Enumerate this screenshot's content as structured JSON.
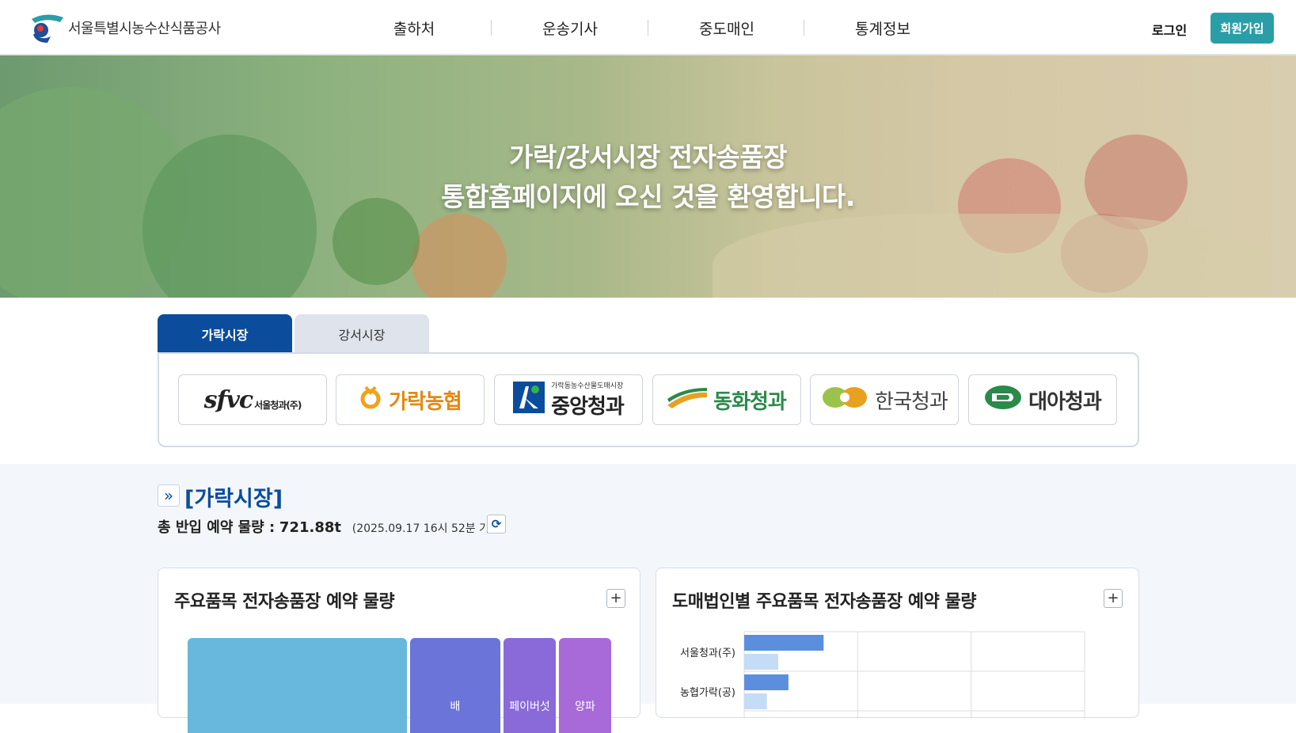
{
  "header": {
    "brand": "서울특별시농수산식품공사",
    "nav": [
      "출하처",
      "운송기사",
      "중도매인",
      "통계정보"
    ],
    "login": "로그인",
    "join": "회원가입",
    "colors": {
      "accent": "#2a9ea7",
      "primary": "#0b4c9c"
    }
  },
  "hero": {
    "line1": "가락/강서시장 전자송품장",
    "line2": "통합홈페이지에 오신 것을 환영합니다."
  },
  "market_tabs": {
    "active": "가락시장",
    "inactive": "강서시장"
  },
  "companies": [
    {
      "name": "서울청과(주)",
      "logo_text": "sfvc",
      "icon": "sfvc-logo-icon"
    },
    {
      "name": "가락농협",
      "icon": "garak-nonghyup-icon",
      "color": "#e5880f"
    },
    {
      "name": "중앙청과",
      "subtitle": "가락동농수산물도매시장",
      "icon": "jungang-logo-icon",
      "color": "#0b4c9c"
    },
    {
      "name": "동화청과",
      "icon": "donghwa-logo-icon",
      "color": "#2a8a4a"
    },
    {
      "name": "한국청과",
      "icon": "hankook-logo-icon",
      "color": "#444444"
    },
    {
      "name": "대아청과",
      "icon": "daea-logo-icon",
      "color": "#333333"
    }
  ],
  "section": {
    "title": "[가락시장]",
    "total_label": "총 반입 예약 물량 :",
    "total_value": "721.88t",
    "as_of": "(2025.09.17  16시 52분 기준)"
  },
  "cards": {
    "left_title": "주요품목 전자송품장 예약 물량",
    "right_title": "도매법인별 주요품목 전자송품장 예약 물량"
  },
  "treemap": {
    "cells": [
      {
        "label": "",
        "color": "#68b7dc"
      },
      {
        "label": "배",
        "color": "#6a74d9"
      },
      {
        "label": "페이버섯",
        "color": "#8a6ad9"
      },
      {
        "label": "양파",
        "color": "#a86ad9"
      }
    ]
  },
  "chart_data": {
    "type": "bar",
    "orientation": "horizontal",
    "categories": [
      "서울청과(주)",
      "농협가락(공)"
    ],
    "series": [
      {
        "values": [
          70,
          39
        ],
        "color": "#5b8fde"
      },
      {
        "values": [
          30,
          20
        ],
        "color": "#c4dcf5"
      }
    ]
  }
}
